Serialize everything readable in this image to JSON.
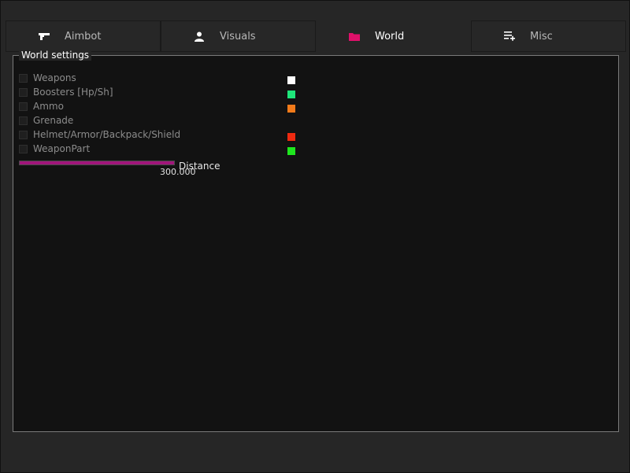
{
  "tabs": [
    {
      "label": "Aimbot",
      "icon": "gun-icon"
    },
    {
      "label": "Visuals",
      "icon": "person-icon"
    },
    {
      "label": "World",
      "icon": "folder-icon",
      "active": true
    },
    {
      "label": "Misc",
      "icon": "list-add-icon"
    }
  ],
  "world": {
    "title": "World settings",
    "options": [
      {
        "label": "Weapons",
        "checked": false,
        "color": "#ffffff"
      },
      {
        "label": "Boosters [Hp/Sh]",
        "checked": false,
        "color": "#1ee67a"
      },
      {
        "label": "Ammo",
        "checked": false,
        "color": "#f27a1a"
      },
      {
        "label": "Grenade",
        "checked": false,
        "color": null
      },
      {
        "label": "Helmet/Armor/Backpack/Shield",
        "checked": false,
        "color": "#ee2a10"
      },
      {
        "label": "WeaponPart",
        "checked": false,
        "color": "#1ee61e"
      }
    ],
    "distance": {
      "label": "Distance",
      "value": "300.000",
      "fill_fraction": 1.0
    }
  },
  "colors": {
    "accent": "#e0106a",
    "slider": "#a0157a"
  }
}
